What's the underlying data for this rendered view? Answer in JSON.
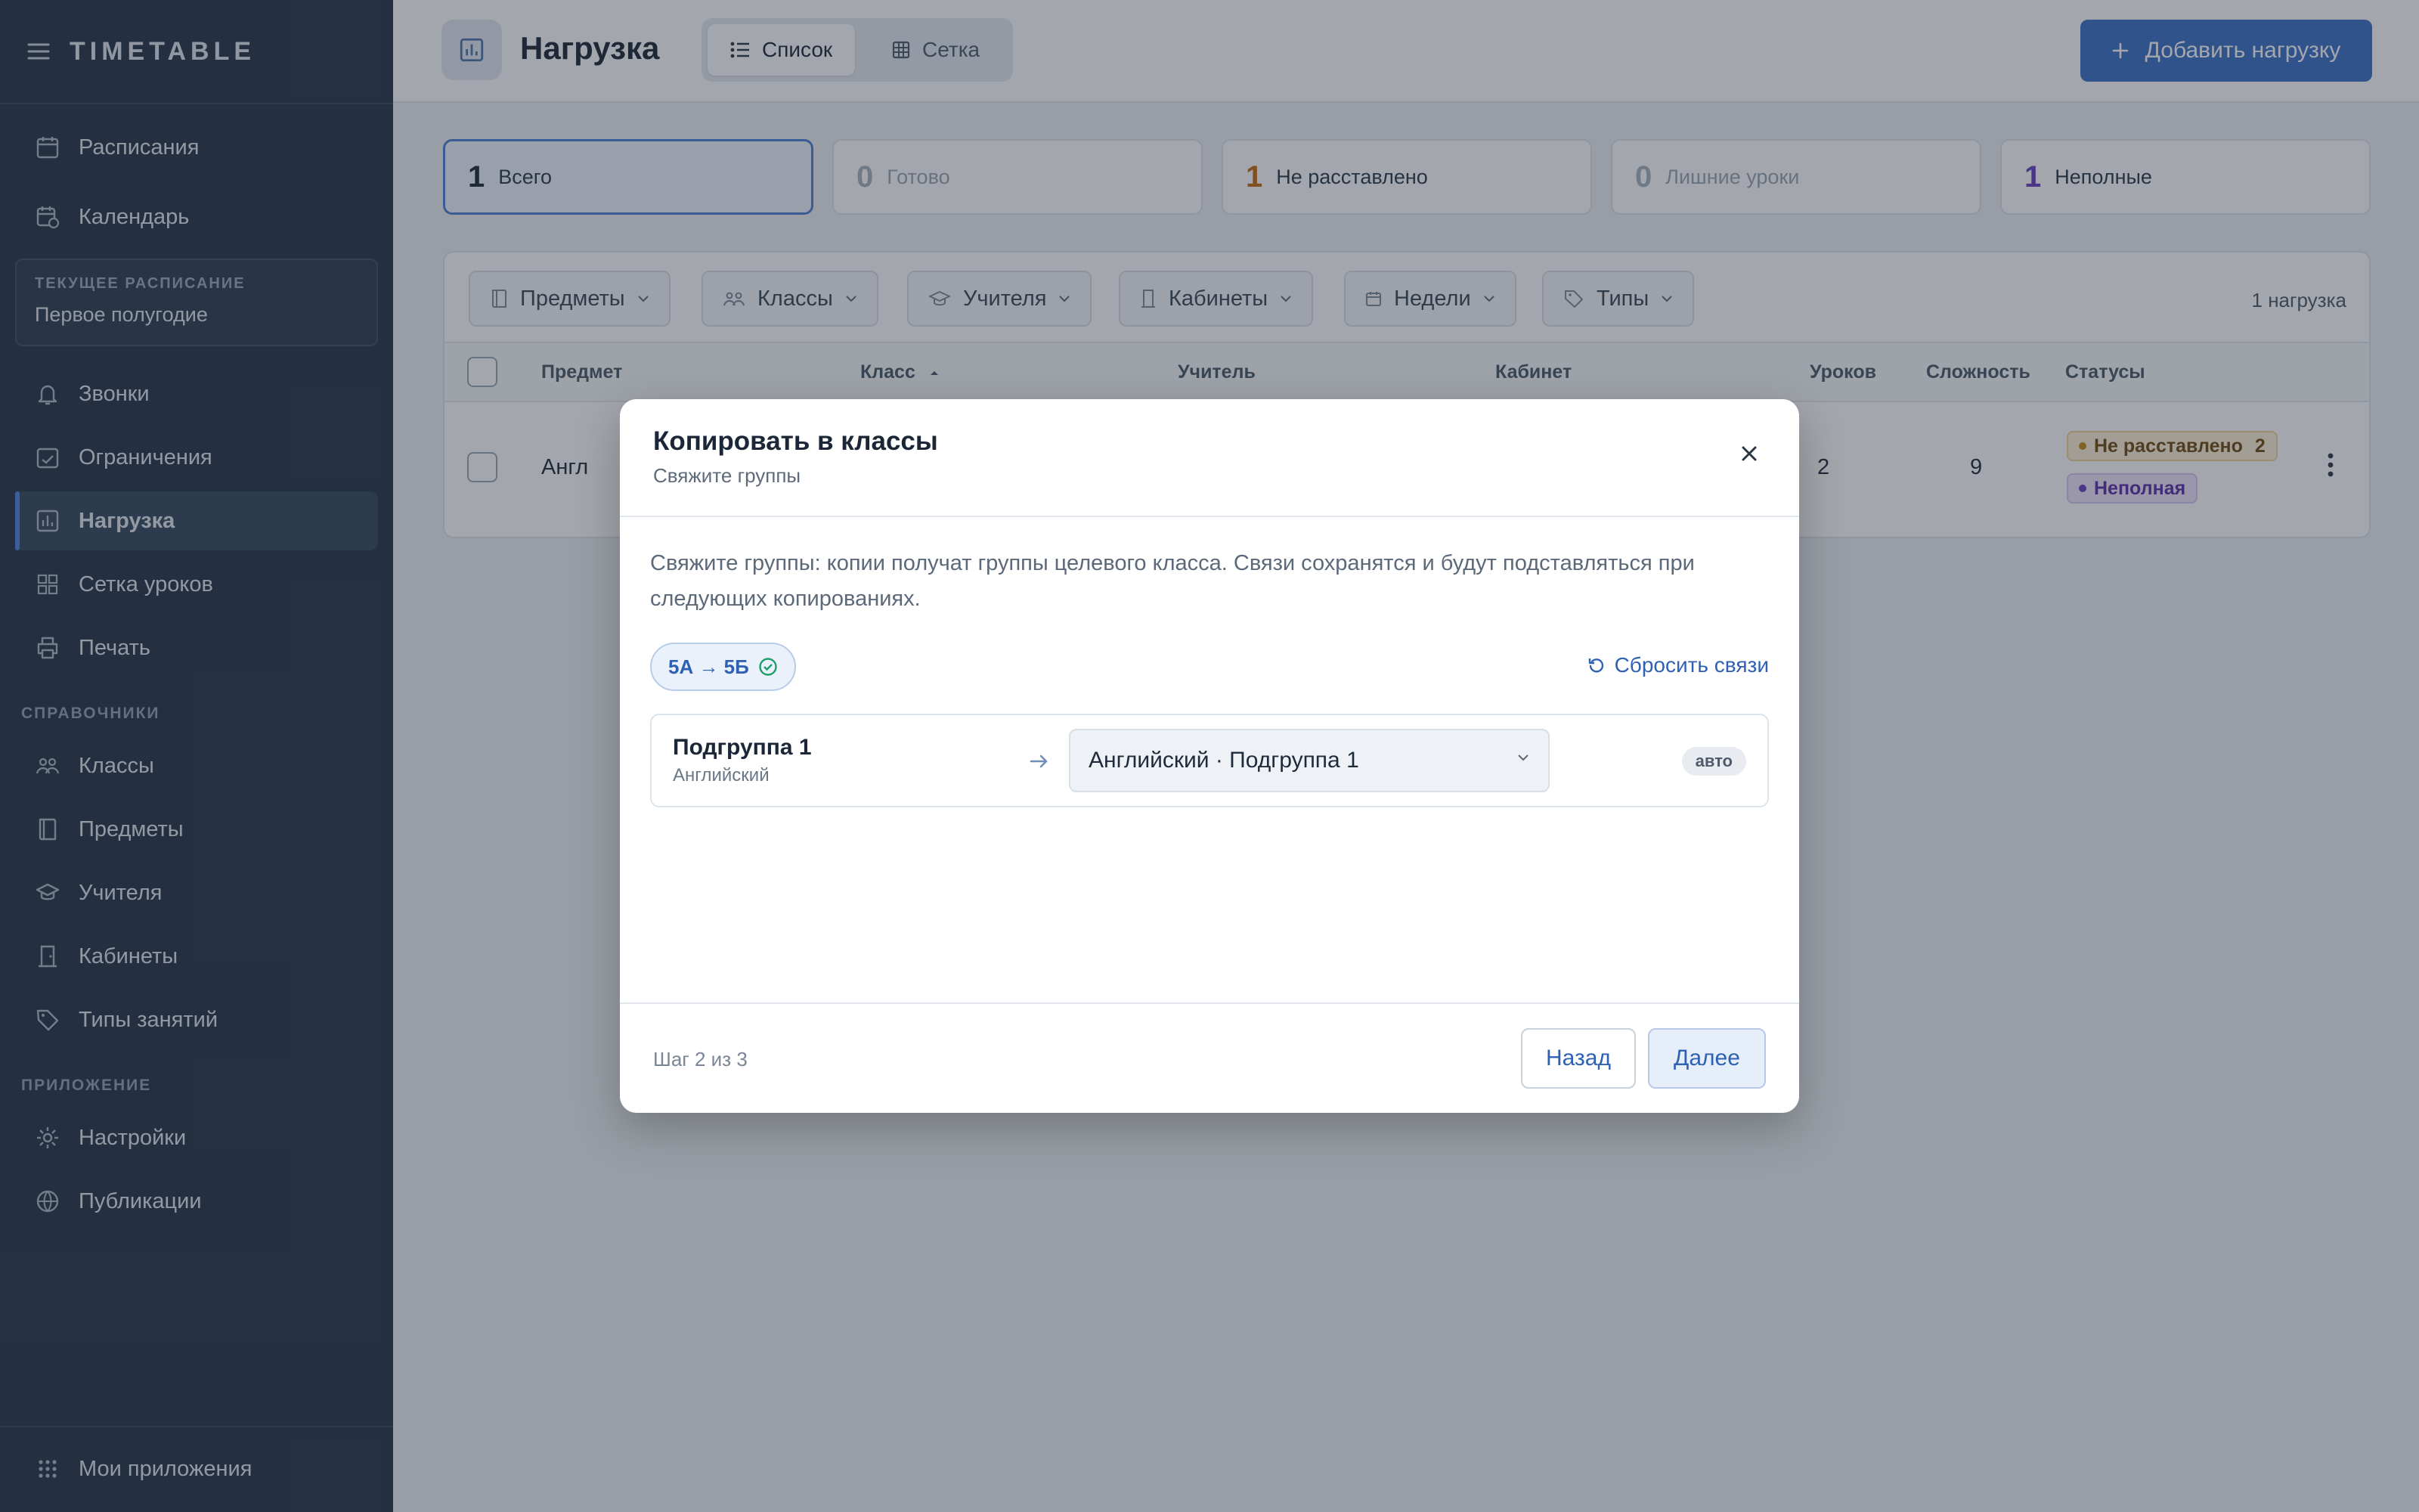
{
  "sidebar": {
    "brand": "TIMETABLE",
    "items_top": [
      {
        "label": "Расписания",
        "icon": "calendar-icon"
      },
      {
        "label": "Календарь",
        "icon": "calendar-clock-icon"
      }
    ],
    "current_schedule": {
      "label": "ТЕКУЩЕЕ РАСПИСАНИЕ",
      "value": "Первое полугодие"
    },
    "items_main": [
      {
        "label": "Звонки",
        "icon": "bell-icon"
      },
      {
        "label": "Ограничения",
        "icon": "calendar-check-icon"
      },
      {
        "label": "Нагрузка",
        "icon": "chart-icon",
        "active": true
      },
      {
        "label": "Сетка уроков",
        "icon": "grid-icon"
      },
      {
        "label": "Печать",
        "icon": "printer-icon"
      }
    ],
    "section_refs": "СПРАВОЧНИКИ",
    "items_refs": [
      {
        "label": "Классы",
        "icon": "users-icon"
      },
      {
        "label": "Предметы",
        "icon": "book-icon"
      },
      {
        "label": "Учителя",
        "icon": "graduation-cap-icon"
      },
      {
        "label": "Кабинеты",
        "icon": "door-icon"
      },
      {
        "label": "Типы занятий",
        "icon": "tag-icon"
      }
    ],
    "section_app": "ПРИЛОЖЕНИЕ",
    "items_app": [
      {
        "label": "Настройки",
        "icon": "gear-icon"
      },
      {
        "label": "Публикации",
        "icon": "globe-icon"
      }
    ],
    "bottom": {
      "label": "Мои приложения",
      "icon": "apps-grid-icon"
    }
  },
  "header": {
    "title": "Нагрузка",
    "view_list": "Список",
    "view_grid": "Сетка",
    "add_button": "Добавить нагрузку"
  },
  "stats": [
    {
      "num": "1",
      "label": "Всего",
      "color": "#1b2636"
    },
    {
      "num": "0",
      "label": "Готово",
      "color": "#a7b1bd"
    },
    {
      "num": "1",
      "label": "Не расставлено",
      "color": "#c56a12"
    },
    {
      "num": "0",
      "label": "Лишние уроки",
      "color": "#a7b1bd"
    },
    {
      "num": "1",
      "label": "Неполные",
      "color": "#6a3fc2"
    }
  ],
  "filters": {
    "subjects": "Предметы",
    "classes": "Классы",
    "teachers": "Учителя",
    "rooms": "Кабинеты",
    "weeks": "Недели",
    "types": "Типы",
    "count": "1 нагрузка"
  },
  "table": {
    "headers": {
      "subject": "Предмет",
      "class": "Класс",
      "teacher": "Учитель",
      "room": "Кабинет",
      "lessons": "Уроков",
      "complexity": "Сложность",
      "statuses": "Статусы"
    },
    "row": {
      "subject": "Англ",
      "lessons": "2",
      "complexity": "9",
      "status_unplaced": "Не расставлено",
      "status_unplaced_count": "2",
      "status_incomplete": "Неполная"
    }
  },
  "modal": {
    "title": "Копировать в классы",
    "subtitle": "Свяжите группы",
    "description": "Свяжите группы: копии получат группы целевого класса. Связи сохранятся и будут подставляться при следующих копированиях.",
    "pair": "5А → 5Б",
    "reset": "Сбросить связи",
    "mapping": {
      "group_name": "Подгруппа 1",
      "group_subject": "Английский",
      "target": "Английский · Подгруппа 1",
      "tag": "авто"
    },
    "step": "Шаг 2 из 3",
    "back": "Назад",
    "next": "Далее"
  },
  "colors": {
    "accent": "#3a70c9",
    "sidebar_bg": "#253547",
    "warning": "#c56a12",
    "purple": "#6a3fc2",
    "success": "#1f9d6b"
  }
}
